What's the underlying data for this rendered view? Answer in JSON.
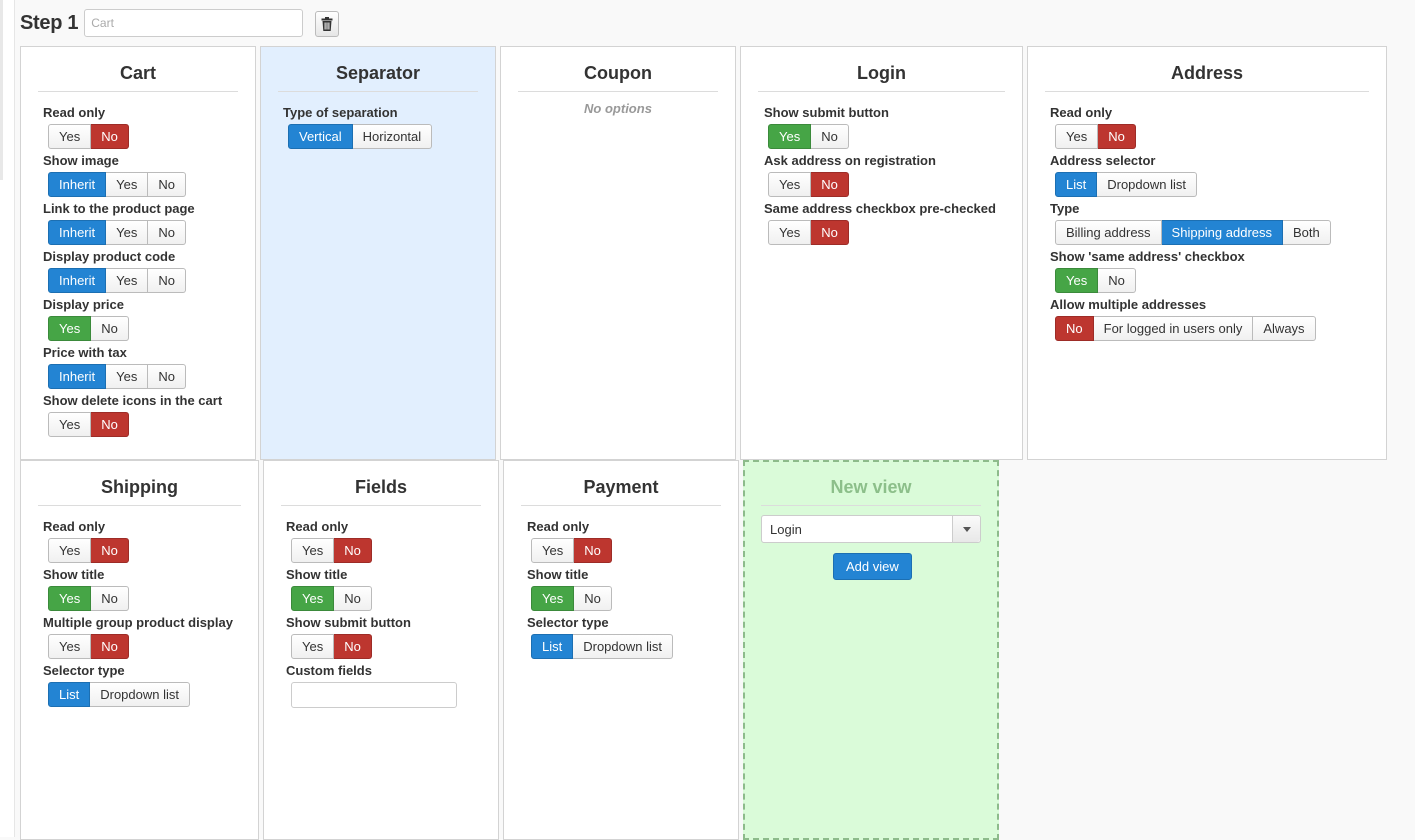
{
  "step": {
    "title": "Step 1",
    "input_placeholder": "Cart"
  },
  "panels": {
    "cart": {
      "title": "Cart",
      "options": [
        {
          "label": "Read only",
          "buttons": [
            "Yes",
            "No"
          ],
          "selected": "No",
          "color": "red"
        },
        {
          "label": "Show image",
          "buttons": [
            "Inherit",
            "Yes",
            "No"
          ],
          "selected": "Inherit",
          "color": "blue"
        },
        {
          "label": "Link to the product page",
          "buttons": [
            "Inherit",
            "Yes",
            "No"
          ],
          "selected": "Inherit",
          "color": "blue"
        },
        {
          "label": "Display product code",
          "buttons": [
            "Inherit",
            "Yes",
            "No"
          ],
          "selected": "Inherit",
          "color": "blue"
        },
        {
          "label": "Display price",
          "buttons": [
            "Yes",
            "No"
          ],
          "selected": "Yes",
          "color": "green"
        },
        {
          "label": "Price with tax",
          "buttons": [
            "Inherit",
            "Yes",
            "No"
          ],
          "selected": "Inherit",
          "color": "blue"
        },
        {
          "label": "Show delete icons in the cart",
          "buttons": [
            "Yes",
            "No"
          ],
          "selected": "No",
          "color": "red"
        }
      ]
    },
    "separator": {
      "title": "Separator",
      "options": [
        {
          "label": "Type of separation",
          "buttons": [
            "Vertical",
            "Horizontal"
          ],
          "selected": "Vertical",
          "color": "blue"
        }
      ]
    },
    "coupon": {
      "title": "Coupon",
      "no_options": "No options"
    },
    "login": {
      "title": "Login",
      "options": [
        {
          "label": "Show submit button",
          "buttons": [
            "Yes",
            "No"
          ],
          "selected": "Yes",
          "color": "green"
        },
        {
          "label": "Ask address on registration",
          "buttons": [
            "Yes",
            "No"
          ],
          "selected": "No",
          "color": "red"
        },
        {
          "label": "Same address checkbox pre-checked",
          "buttons": [
            "Yes",
            "No"
          ],
          "selected": "No",
          "color": "red"
        }
      ]
    },
    "address": {
      "title": "Address",
      "options": [
        {
          "label": "Read only",
          "buttons": [
            "Yes",
            "No"
          ],
          "selected": "No",
          "color": "red"
        },
        {
          "label": "Address selector",
          "buttons": [
            "List",
            "Dropdown list"
          ],
          "selected": "List",
          "color": "blue"
        },
        {
          "label": "Type",
          "buttons": [
            "Billing address",
            "Shipping address",
            "Both"
          ],
          "selected": "Shipping address",
          "color": "blue"
        },
        {
          "label": "Show 'same address' checkbox",
          "buttons": [
            "Yes",
            "No"
          ],
          "selected": "Yes",
          "color": "green"
        },
        {
          "label": "Allow multiple addresses",
          "buttons": [
            "No",
            "For logged in users only",
            "Always"
          ],
          "selected": "No",
          "color": "red"
        }
      ]
    },
    "shipping": {
      "title": "Shipping",
      "options": [
        {
          "label": "Read only",
          "buttons": [
            "Yes",
            "No"
          ],
          "selected": "No",
          "color": "red"
        },
        {
          "label": "Show title",
          "buttons": [
            "Yes",
            "No"
          ],
          "selected": "Yes",
          "color": "green"
        },
        {
          "label": "Multiple group product display",
          "buttons": [
            "Yes",
            "No"
          ],
          "selected": "No",
          "color": "red"
        },
        {
          "label": "Selector type",
          "buttons": [
            "List",
            "Dropdown list"
          ],
          "selected": "List",
          "color": "blue"
        }
      ]
    },
    "fields": {
      "title": "Fields",
      "options": [
        {
          "label": "Read only",
          "buttons": [
            "Yes",
            "No"
          ],
          "selected": "No",
          "color": "red"
        },
        {
          "label": "Show title",
          "buttons": [
            "Yes",
            "No"
          ],
          "selected": "Yes",
          "color": "green"
        },
        {
          "label": "Show submit button",
          "buttons": [
            "Yes",
            "No"
          ],
          "selected": "No",
          "color": "red"
        },
        {
          "label": "Custom fields",
          "field_value": ""
        }
      ]
    },
    "payment": {
      "title": "Payment",
      "options": [
        {
          "label": "Read only",
          "buttons": [
            "Yes",
            "No"
          ],
          "selected": "No",
          "color": "red"
        },
        {
          "label": "Show title",
          "buttons": [
            "Yes",
            "No"
          ],
          "selected": "Yes",
          "color": "green"
        },
        {
          "label": "Selector type",
          "buttons": [
            "List",
            "Dropdown list"
          ],
          "selected": "List",
          "color": "blue"
        }
      ]
    },
    "new_view": {
      "title": "New view",
      "select_value": "Login",
      "add_button": "Add view"
    }
  },
  "colors": {
    "blue": "#2384d3",
    "red": "#bd362f",
    "green": "#46a546",
    "separator_bg": "#e2effe",
    "new_view_bg": "#dafbd9"
  },
  "icons": {
    "delete": "trash-icon",
    "dropdown": "caret-down-icon"
  }
}
